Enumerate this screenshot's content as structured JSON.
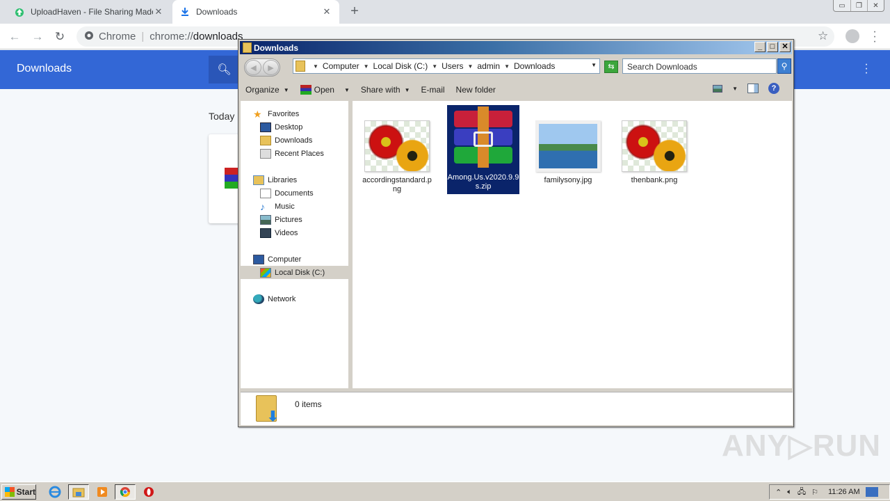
{
  "browser": {
    "tabs": [
      {
        "label": "UploadHaven - File Sharing Made Sim",
        "icon": "uploadhaven-icon",
        "active": false
      },
      {
        "label": "Downloads",
        "icon": "download-icon",
        "active": true
      }
    ],
    "new_tab": "+",
    "omnibox": {
      "site_label": "Chrome",
      "separator": "|",
      "url_scheme": "chrome://",
      "url_host": "downloads"
    }
  },
  "downloads_page": {
    "title": "Downloads",
    "section_today": "Today"
  },
  "explorer": {
    "title": "Downloads",
    "breadcrumb": [
      "Computer",
      "Local Disk (C:)",
      "Users",
      "admin",
      "Downloads"
    ],
    "search_placeholder": "Search Downloads",
    "commands": [
      {
        "label": "Organize",
        "dropdown": true
      },
      {
        "label": "Open",
        "dropdown": true,
        "icon": "winrar-icon"
      },
      {
        "label": "Share with",
        "dropdown": true
      },
      {
        "label": "E-mail",
        "dropdown": false
      },
      {
        "label": "New folder",
        "dropdown": false
      }
    ],
    "nav": {
      "favorites": {
        "label": "Favorites",
        "items": [
          "Desktop",
          "Downloads",
          "Recent Places"
        ]
      },
      "libraries": {
        "label": "Libraries",
        "items": [
          "Documents",
          "Music",
          "Pictures",
          "Videos"
        ]
      },
      "computer": {
        "label": "Computer",
        "items": [
          "Local Disk (C:)"
        ]
      },
      "network": {
        "label": "Network"
      }
    },
    "selected_nav": "Local Disk (C:)",
    "files": [
      {
        "name": "accordingstandard.png",
        "type": "png",
        "selected": false
      },
      {
        "name": "Among.Us.v2020.9.9s.zip",
        "type": "zip",
        "selected": true
      },
      {
        "name": "familysony.jpg",
        "type": "jpg",
        "selected": false
      },
      {
        "name": "thenbank.png",
        "type": "png",
        "selected": false
      }
    ],
    "status": "0 items"
  },
  "taskbar": {
    "start_label": "Start",
    "apps": [
      "internet-explorer",
      "windows-explorer",
      "media-player",
      "chrome",
      "opera"
    ],
    "clock": "11:26 AM"
  },
  "watermark": "ANY▷RUN"
}
